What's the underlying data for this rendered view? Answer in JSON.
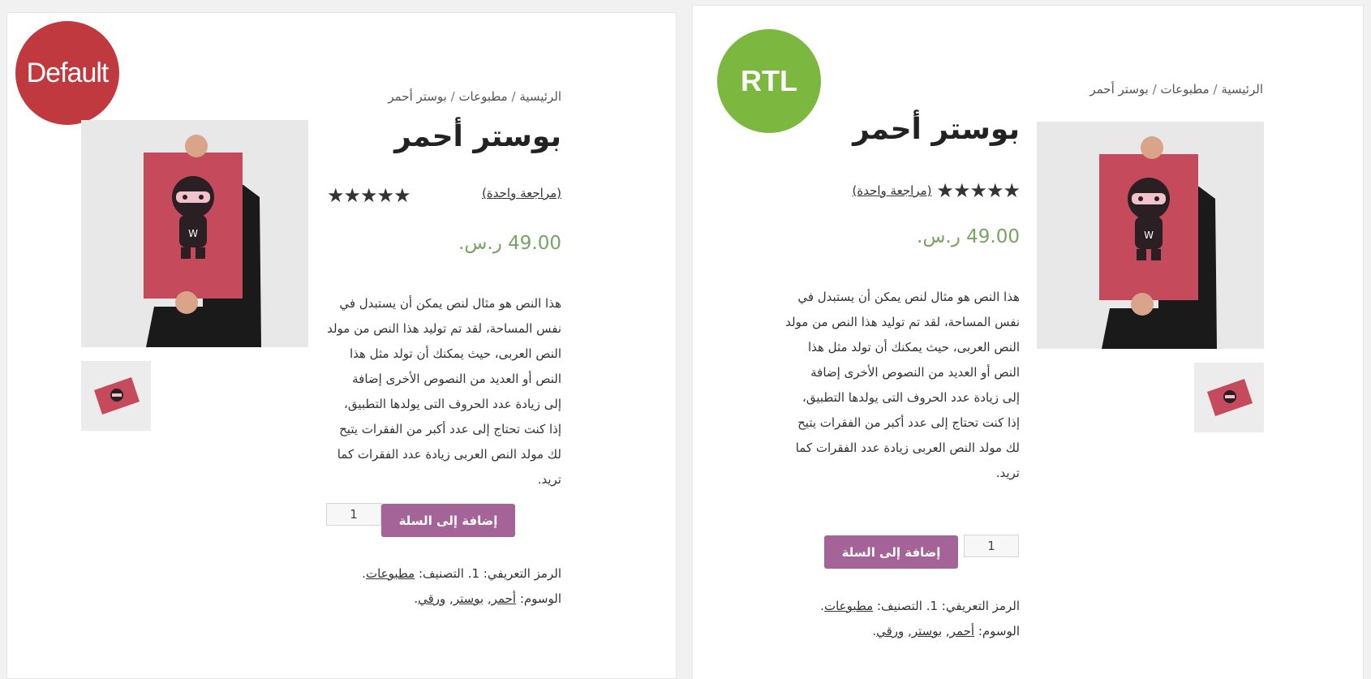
{
  "badges": {
    "left": "Default",
    "right": "RTL"
  },
  "breadcrumb": {
    "home": "الرئيسية",
    "category": "مطبوعات",
    "current": "بوستر أحمر",
    "sep": "/"
  },
  "product": {
    "title": "بوستر أحمر",
    "review_link": "(مراجعة واحدة)",
    "stars": "★★★★★",
    "rating": 5,
    "price": "49.00 ر.س.",
    "description_lines": [
      "هذا النص هو مثال لنص يمكن أن يستبدل في",
      "نفس المساحة، لقد تم توليد هذا النص من مولد",
      "النص العربى، حيث يمكنك أن تولد مثل هذا",
      "النص أو العديد من النصوص الأخرى إضافة",
      "إلى زيادة عدد الحروف التى يولدها التطبيق،",
      "إذا كنت تحتاج إلى عدد أكبر من الفقرات يتيح",
      "لك مولد النص العربى زيادة عدد الفقرات كما",
      "تريد."
    ],
    "quantity": "1",
    "add_to_cart": "إضافة إلى السلة",
    "sku_label": "الرمز التعريفي:",
    "sku_value": "1.",
    "category_label": "التصنيف:",
    "category_value": "مطبوعات",
    "tags_label": "الوسوم:",
    "tags": [
      "أحمر",
      "بوستر",
      "ورقي"
    ]
  },
  "colors": {
    "badge_default": "#c0393e",
    "badge_rtl": "#7cb740",
    "price": "#77a464",
    "button": "#a46497"
  }
}
